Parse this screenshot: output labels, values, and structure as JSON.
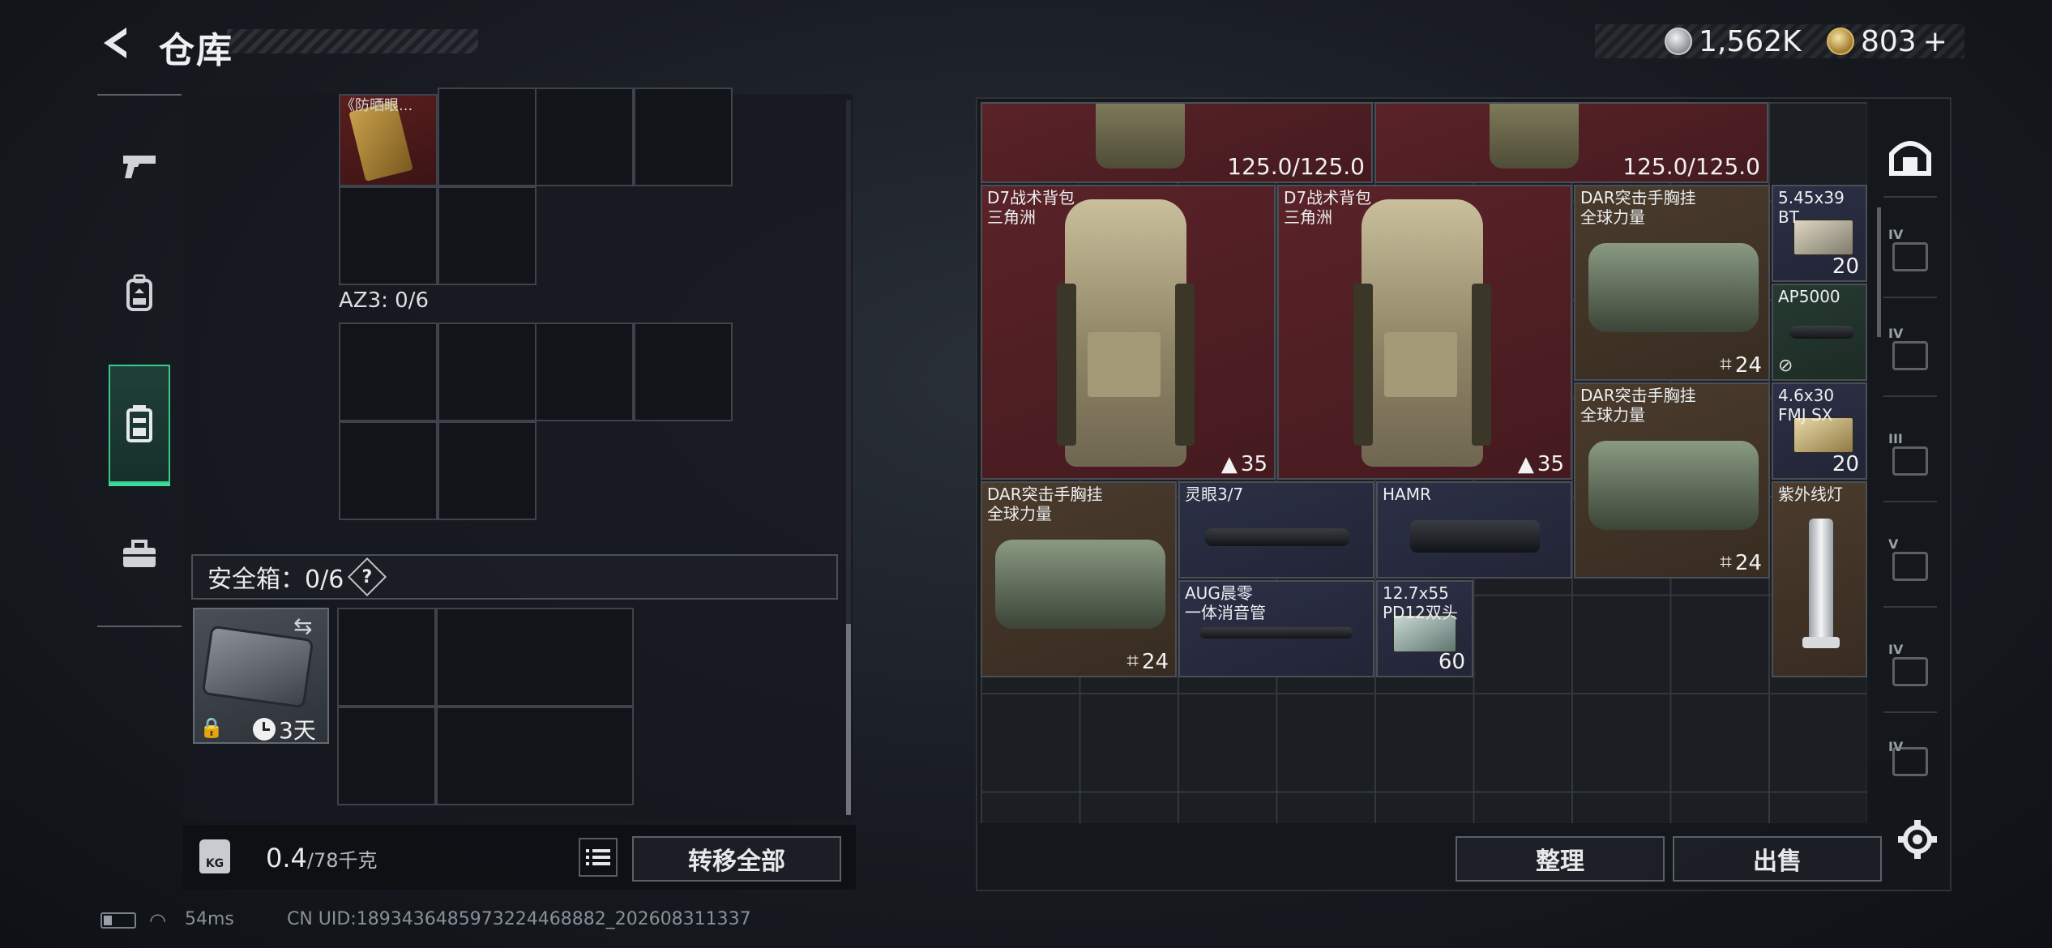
{
  "header": {
    "title": "仓库",
    "currency_silver": "1,562K",
    "currency_gold": "803",
    "currency_gold_plus": "+"
  },
  "left_nav": {
    "items": [
      {
        "icon": "pistol-icon"
      },
      {
        "icon": "backpack-icon"
      },
      {
        "icon": "rig-icon",
        "active": true
      },
      {
        "icon": "toolbox-icon"
      }
    ]
  },
  "left_panel": {
    "ticket_name": "《防晒眼...",
    "az3_label": "AZ3: 0/6",
    "safe_label": "安全箱：0/6",
    "safe_help": "?",
    "case_timer": "3天"
  },
  "weight": {
    "current": "0.4",
    "max": "/78千克",
    "kg_badge": "KG"
  },
  "buttons": {
    "transfer_all": "转移全部",
    "sort": "整理",
    "sell": "出售"
  },
  "status": {
    "ping": "54ms",
    "uid": "CN UID:1893436485973224468882_202608311337"
  },
  "stash": {
    "items": [
      {
        "name": "",
        "durability": "125.0/125.0"
      },
      {
        "name": "",
        "durability": "125.0/125.0"
      },
      {
        "name": "D7战术背包\n三角洲",
        "capacity": "35"
      },
      {
        "name": "D7战术背包\n三角洲",
        "capacity": "35"
      },
      {
        "name": "DAR突击手胸挂\n全球力量",
        "capacity": "24"
      },
      {
        "name": "5.45x39\nBT",
        "qty": "20"
      },
      {
        "name": "AP5000",
        "qty": ""
      },
      {
        "name": "DAR突击手胸挂\n全球力量",
        "capacity": "24"
      },
      {
        "name": "4.6x30\nFMJ SX",
        "qty": "20"
      },
      {
        "name": "DAR突击手胸挂\n全球力量",
        "capacity": "24"
      },
      {
        "name": "灵眼3/7",
        "qty": ""
      },
      {
        "name": "HAMR",
        "qty": ""
      },
      {
        "name": "紫外线灯",
        "qty": ""
      },
      {
        "name": "AUG晨零\n一体消音管",
        "qty": ""
      },
      {
        "name": "12.7x55\nPD12双头",
        "qty": "60"
      }
    ]
  },
  "right_strip": {
    "tabs": [
      {
        "tier": "",
        "icon": "home-vault-icon"
      },
      {
        "tier": "IV",
        "icon": "tier-item-icon"
      },
      {
        "tier": "IV",
        "icon": "tier-medkit-icon"
      },
      {
        "tier": "III",
        "icon": "tier-warning-icon"
      },
      {
        "tier": "V",
        "icon": "tier-case-icon"
      },
      {
        "tier": "IV",
        "icon": "tier-case-icon"
      },
      {
        "tier": "IV",
        "icon": "tier-case-icon"
      }
    ]
  },
  "colors": {
    "accent_green": "#3fd99a",
    "item_red": "#5a2328",
    "item_brown": "#4a3b2c",
    "item_blue": "#2c3046",
    "item_green": "#263a31"
  }
}
